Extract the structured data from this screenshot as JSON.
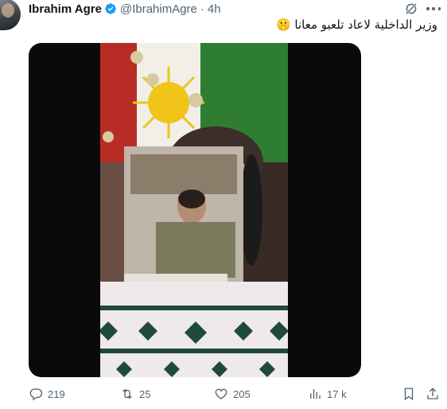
{
  "tweet": {
    "author_name": "Ibrahim Agre",
    "handle": "@IbrahimAgre",
    "separator": "·",
    "time": "4h",
    "text": "وزير الداخلية لاعاد تلعبو معانا 🤫"
  },
  "icons": {
    "verified": "verified-badge-icon",
    "grok": "grok-icon",
    "more": "more-options-icon",
    "reply": "reply-icon",
    "retweet": "retweet-icon",
    "like": "like-icon",
    "views": "views-icon",
    "bookmark": "bookmark-icon",
    "share": "share-icon"
  },
  "actions": {
    "replies": "219",
    "retweets": "25",
    "likes": "205",
    "views": "17 k"
  },
  "colors": {
    "accent": "#1d9bf0",
    "secondary_text": "#536471",
    "primary_text": "#0f1419"
  }
}
